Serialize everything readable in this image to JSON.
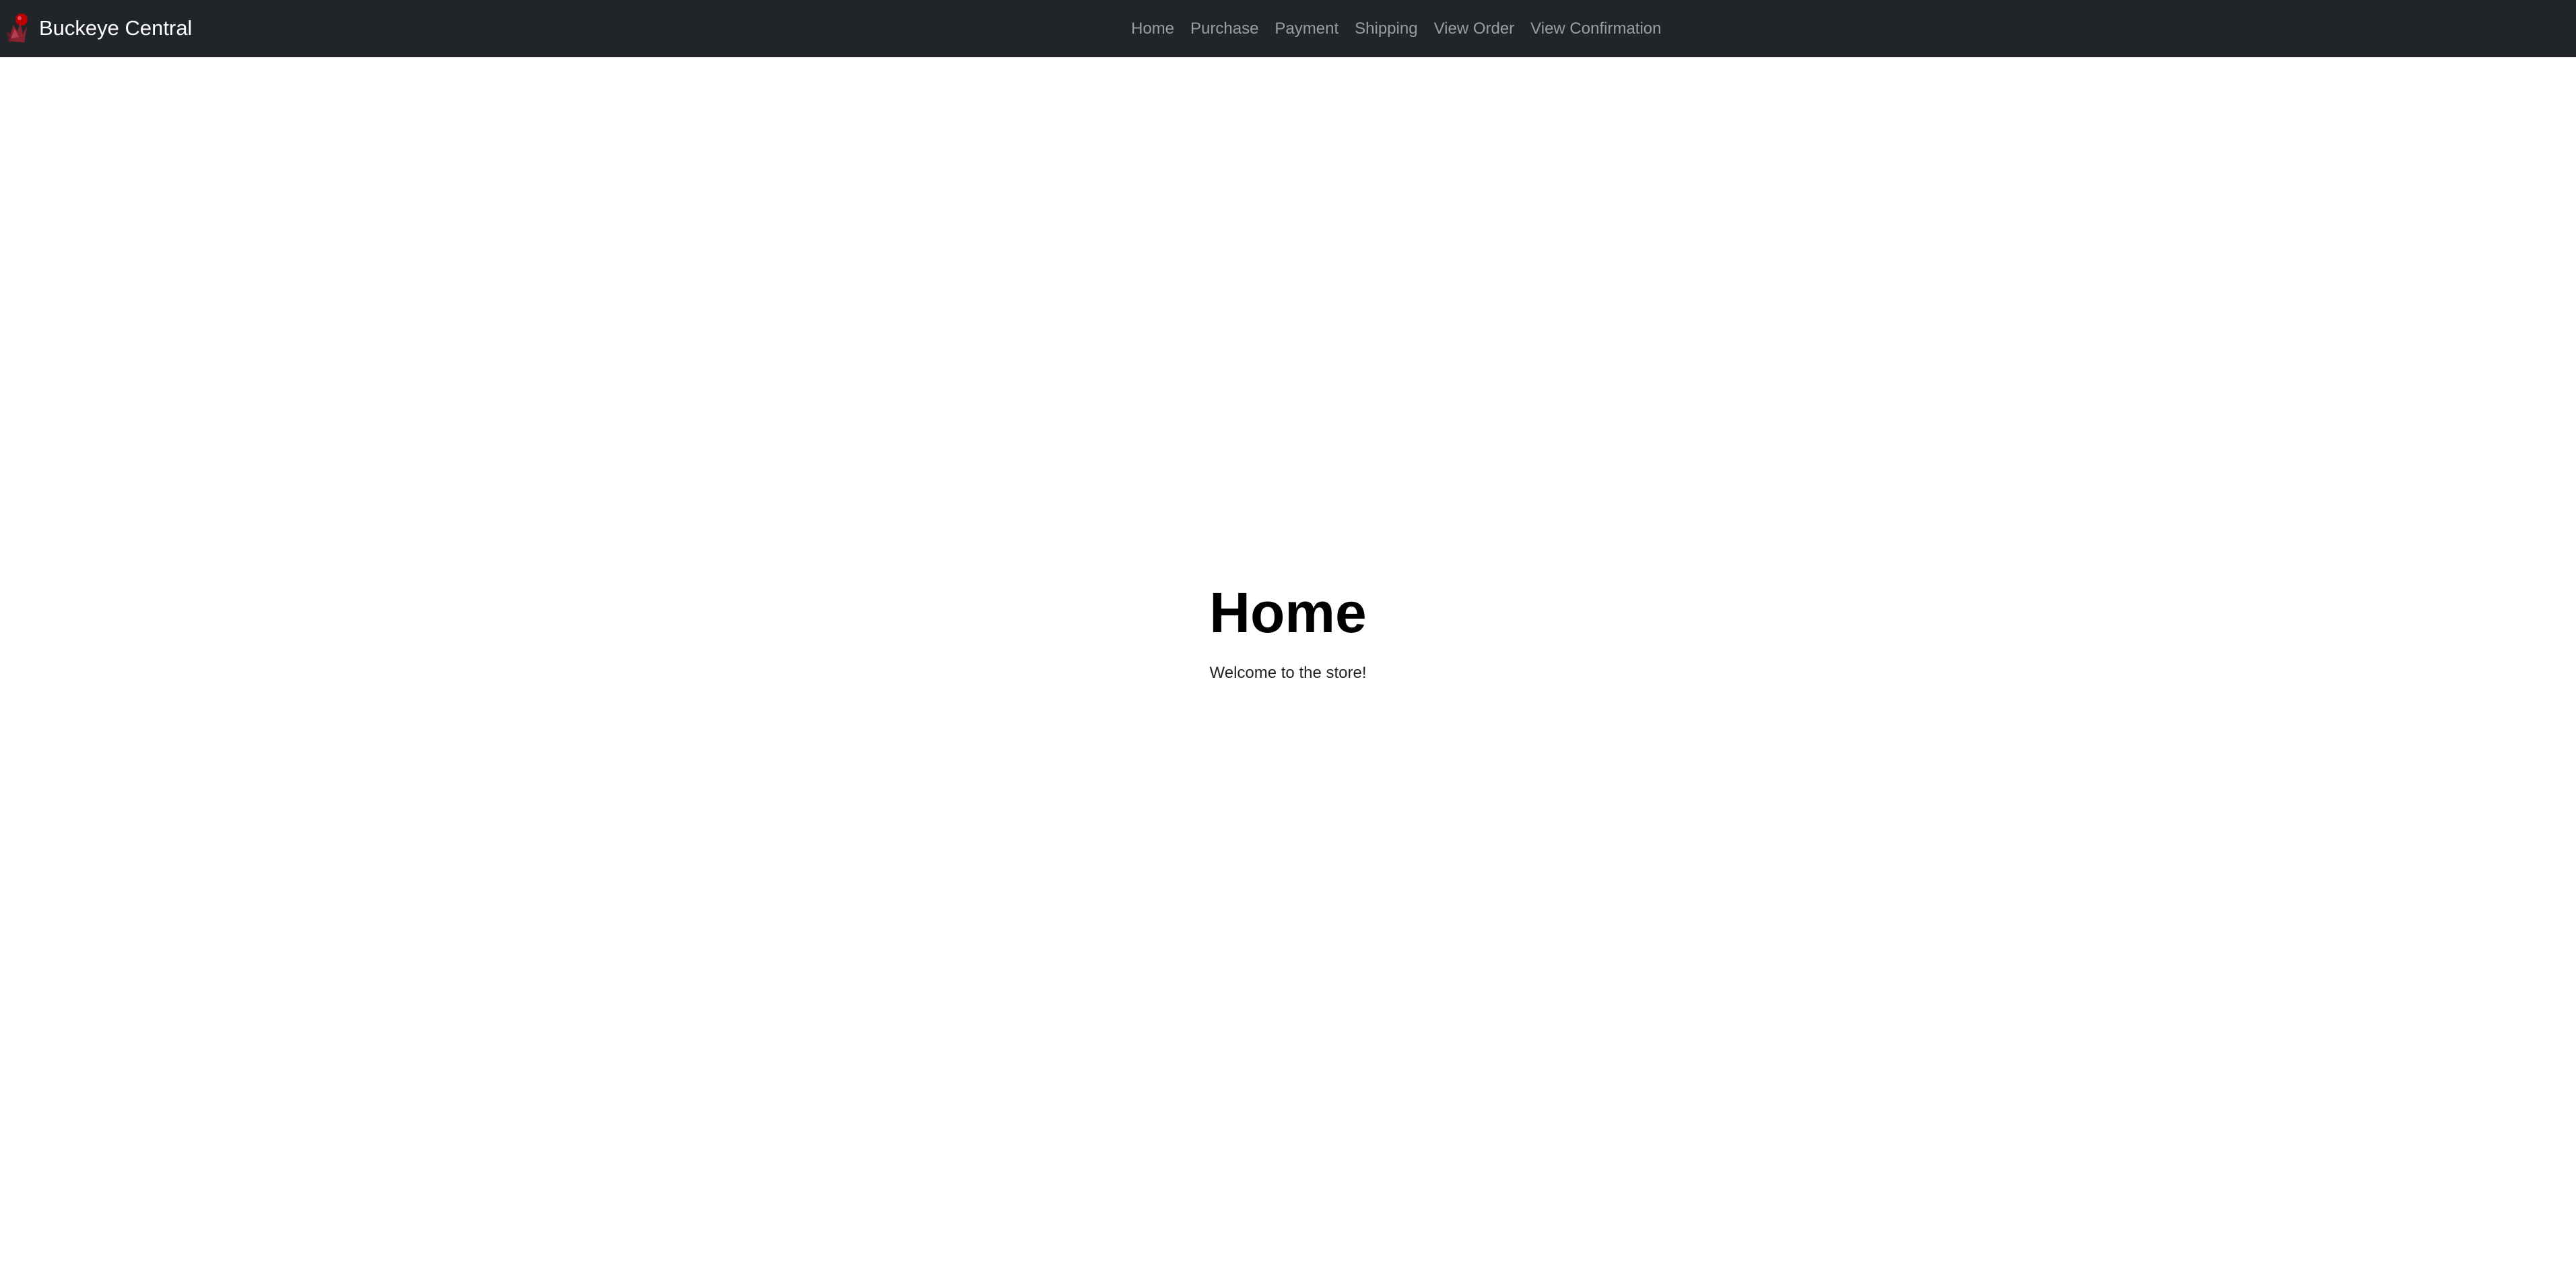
{
  "navbar": {
    "brand": "Buckeye Central",
    "brand_logo_icon": "buckeye-leaf-logo",
    "background_color": "#212529",
    "items": [
      {
        "label": "Home"
      },
      {
        "label": "Purchase"
      },
      {
        "label": "Payment"
      },
      {
        "label": "Shipping"
      },
      {
        "label": "View Order"
      },
      {
        "label": "View Confirmation"
      }
    ]
  },
  "main": {
    "title": "Home",
    "subtitle": "Welcome to the store!"
  },
  "colors": {
    "navbar_bg": "#212529",
    "nav_link": "#9a9da0",
    "logo_accent": "#bb0000"
  }
}
